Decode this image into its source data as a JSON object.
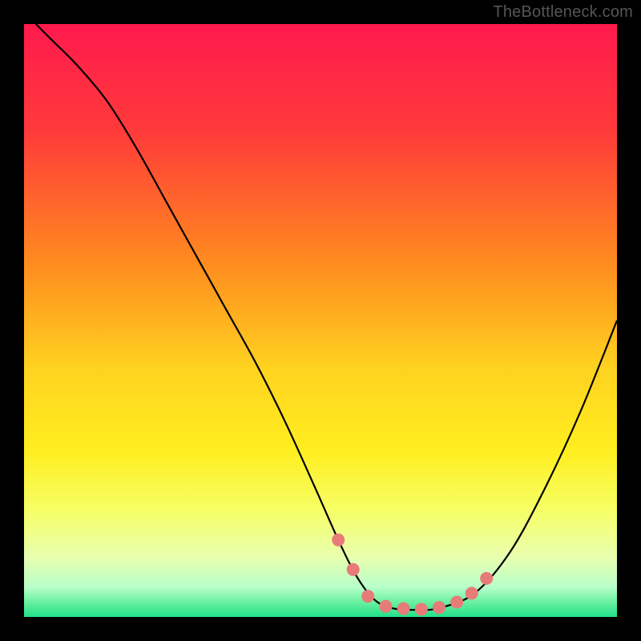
{
  "watermark": "TheBottleneck.com",
  "chart_data": {
    "type": "line",
    "title": "",
    "xlabel": "",
    "ylabel": "",
    "xlim": [
      0,
      100
    ],
    "ylim": [
      0,
      100
    ],
    "background_gradient": {
      "stops": [
        {
          "offset": 0.0,
          "color": "#ff1a4d"
        },
        {
          "offset": 0.18,
          "color": "#ff3a3a"
        },
        {
          "offset": 0.4,
          "color": "#ff8a1f"
        },
        {
          "offset": 0.58,
          "color": "#ffd21f"
        },
        {
          "offset": 0.72,
          "color": "#ffee1f"
        },
        {
          "offset": 0.82,
          "color": "#f6ff66"
        },
        {
          "offset": 0.9,
          "color": "#e8ffb0"
        },
        {
          "offset": 0.95,
          "color": "#b7ffc9"
        },
        {
          "offset": 0.975,
          "color": "#6af0a0"
        },
        {
          "offset": 1.0,
          "color": "#22e08a"
        }
      ]
    },
    "series": [
      {
        "name": "curve",
        "color": "#000000",
        "width": 2.2,
        "x": [
          2,
          5,
          9,
          14,
          19,
          24,
          29,
          34,
          39,
          44,
          49,
          53,
          56,
          59,
          62,
          66,
          70,
          76,
          82,
          88,
          94,
          100
        ],
        "y": [
          100,
          97,
          93,
          87,
          79,
          70,
          61,
          52,
          43,
          33,
          22,
          13,
          7,
          3,
          1.5,
          1.2,
          1.5,
          4,
          11,
          22,
          35,
          50
        ]
      }
    ],
    "markers": {
      "color": "#e77b78",
      "radius": 8,
      "points": [
        {
          "x": 53.0,
          "y": 13.0
        },
        {
          "x": 55.5,
          "y": 8.0
        },
        {
          "x": 58.0,
          "y": 3.5
        },
        {
          "x": 61.0,
          "y": 1.8
        },
        {
          "x": 64.0,
          "y": 1.4
        },
        {
          "x": 67.0,
          "y": 1.3
        },
        {
          "x": 70.0,
          "y": 1.6
        },
        {
          "x": 73.0,
          "y": 2.5
        },
        {
          "x": 75.5,
          "y": 4.0
        },
        {
          "x": 78.0,
          "y": 6.5
        }
      ]
    }
  }
}
